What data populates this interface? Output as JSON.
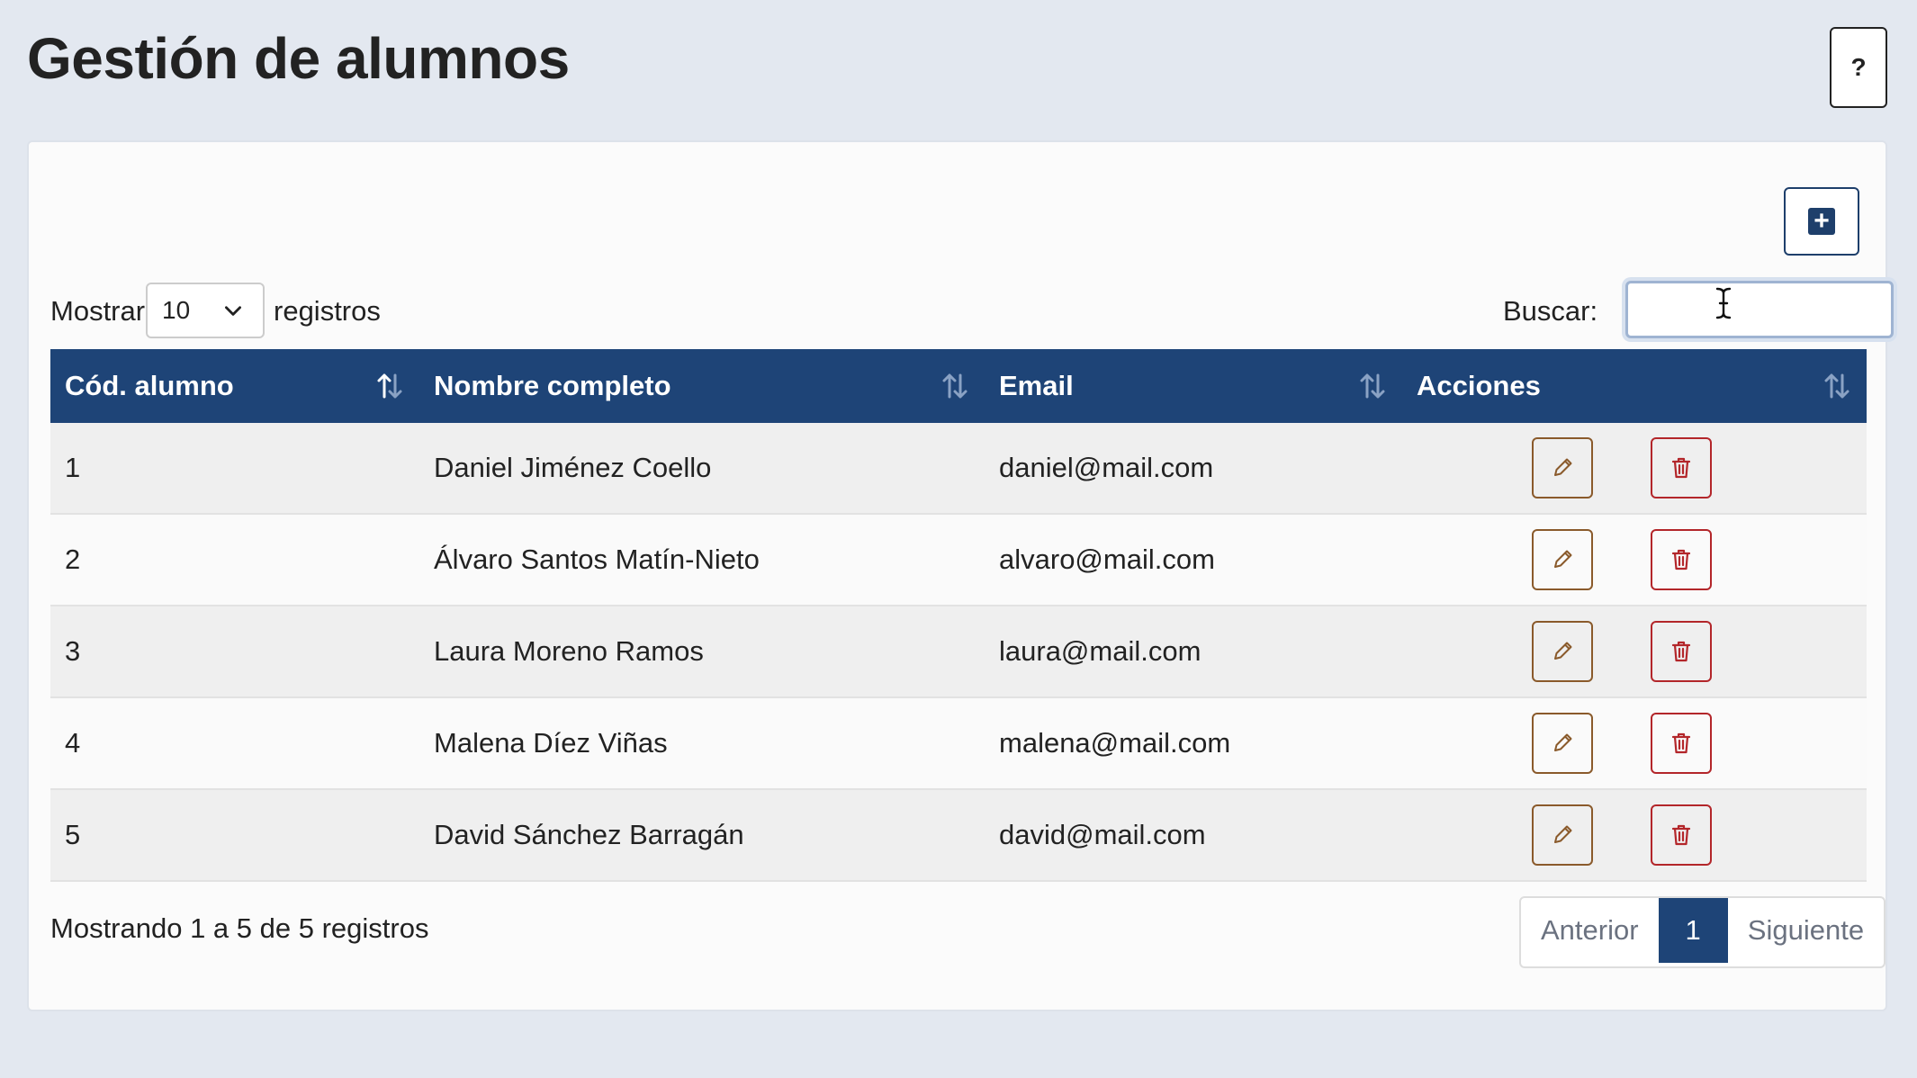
{
  "page": {
    "title": "Gestión de alumnos",
    "help_label": "?"
  },
  "toolbar": {
    "add_icon": "plus-square-icon"
  },
  "controls": {
    "show_label": "Mostrar",
    "page_size": "10",
    "records_label": "registros",
    "search_label": "Buscar:",
    "search_value": ""
  },
  "table": {
    "headers": [
      "Cód. alumno",
      "Nombre completo",
      "Email",
      "Acciones"
    ],
    "rows": [
      {
        "cod": "1",
        "name": "Daniel Jiménez Coello",
        "email": "daniel@mail.com"
      },
      {
        "cod": "2",
        "name": "Álvaro Santos Matín-Nieto",
        "email": "alvaro@mail.com"
      },
      {
        "cod": "3",
        "name": "Laura Moreno Ramos",
        "email": "laura@mail.com"
      },
      {
        "cod": "4",
        "name": "Malena Díez Viñas",
        "email": "malena@mail.com"
      },
      {
        "cod": "5",
        "name": "David Sánchez Barragán",
        "email": "david@mail.com"
      }
    ]
  },
  "footer": {
    "info": "Mostrando 1 a 5 de 5 registros",
    "prev_label": "Anterior",
    "current_page": "1",
    "next_label": "Siguiente"
  },
  "colors": {
    "header_bg": "#1e4477",
    "edit_border": "#8a5a2b",
    "delete_border": "#b3262a"
  }
}
